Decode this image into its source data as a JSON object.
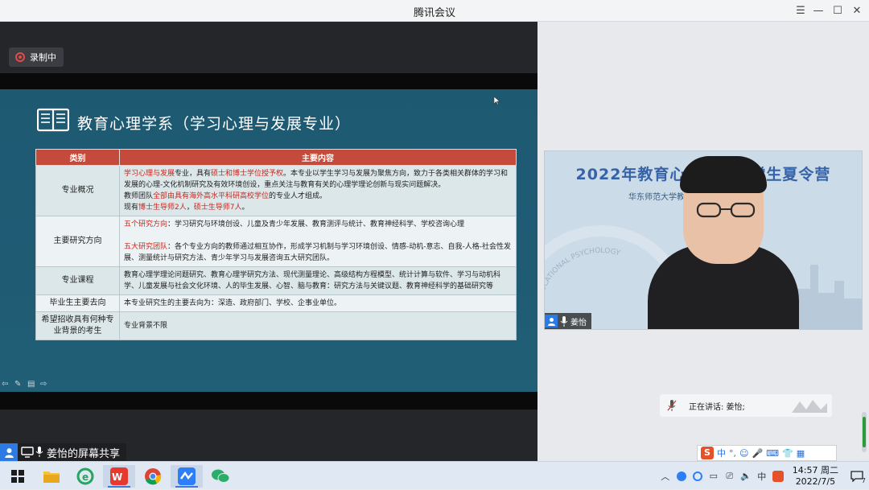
{
  "window": {
    "title": "腾讯会议"
  },
  "recording": {
    "label": "录制中"
  },
  "slide": {
    "title": "教育心理学系（学习心理与发展专业）",
    "table": {
      "headers": [
        "类别",
        "主要内容"
      ],
      "rows": [
        {
          "category": "专业概况",
          "segments": [
            {
              "text": "学习心理与发展",
              "hl": true
            },
            {
              "text": "专业，具有",
              "hl": false
            },
            {
              "text": "硕士和博士学位授予权",
              "hl": true
            },
            {
              "text": "。本专业以学生学习与发展为聚焦方向，致力于各类相关群体的学习和发展的心理-文化机制研究及有效环境创设，重点关注与教育有关的心理学理论创新与现实问题解决。",
              "hl": false
            },
            {
              "text": "\n教师团队",
              "hl": false
            },
            {
              "text": "全部由具有海外高水平科研高校学位",
              "hl": true
            },
            {
              "text": "的专业人才组成。",
              "hl": false
            },
            {
              "text": "\n现有",
              "hl": false
            },
            {
              "text": "博士生导师2人",
              "hl": true
            },
            {
              "text": "，",
              "hl": false
            },
            {
              "text": "硕士生导师7人",
              "hl": true
            },
            {
              "text": "。",
              "hl": false
            }
          ]
        },
        {
          "category": "主要研究方向",
          "segments": [
            {
              "text": "五个研究方向",
              "hl": true
            },
            {
              "text": "：学习研究与环境创设、儿童及青少年发展、教育测评与统计、教育神经科学、学校咨询心理",
              "hl": false
            },
            {
              "text": "\n\n五大研究团队",
              "hl": true
            },
            {
              "text": "：各个专业方向的教师通过相互协作，形成学习机制与学习环境创设、情感-动机-意志、自我-人格-社会性发展、测量统计与研究方法、青少年学习与发展咨询五大研究团队。",
              "hl": false
            }
          ]
        },
        {
          "category": "专业课程",
          "segments": [
            {
              "text": "教育心理学理论问题研究、教育心理学研究方法、现代测量理论、高级结构方程模型、统计计算与软件、学习与动机科学、儿童发展与社会文化环境、人的毕生发展、心智、脑与教育：研究方法与关键议题、教育神经科学的基础研究等",
              "hl": false
            }
          ]
        },
        {
          "category": "毕业生主要去向",
          "segments": [
            {
              "text": "本专业研究生的主要去向为：深造、政府部门、学校、企事业单位。",
              "hl": false
            }
          ]
        },
        {
          "category": "希望招收具有何种专业背景的考生",
          "segments": [
            {
              "text": "专业背景不限",
              "hl": false
            }
          ]
        }
      ]
    }
  },
  "video": {
    "banner": "2022年教育心理学系大学生夏令营",
    "school_text": "华东师范大学教育心理学系",
    "seal_text": "OF EDUCATIONAL PSYCHOLOGY",
    "participant_name": "姜怡"
  },
  "speaking": {
    "label": "正在讲话: 姜怡;"
  },
  "share": {
    "label": "姜怡的屏幕共享"
  },
  "ime": {
    "logo": "S",
    "mode": "中",
    "punct": "°,"
  },
  "taskbar": {
    "apps": [
      "file-explorer",
      "ie-browser",
      "wps-office",
      "chrome",
      "tencent-meeting",
      "wechat"
    ],
    "time": "14:57 周二",
    "date": "2022/7/5",
    "notification_count": "7"
  }
}
